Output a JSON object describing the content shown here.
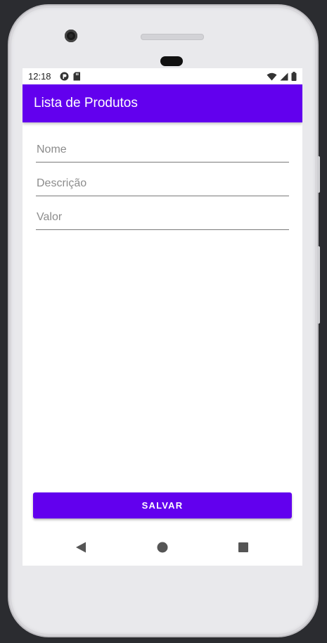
{
  "status_bar": {
    "time": "12:18",
    "left_icons": [
      "app-notification-icon",
      "sd-card-icon"
    ],
    "right_icons": [
      "wifi-icon",
      "cell-signal-icon",
      "battery-icon"
    ]
  },
  "app_bar": {
    "title": "Lista de Produtos",
    "color": "#6200ee"
  },
  "form": {
    "fields": [
      {
        "name": "nome",
        "placeholder": "Nome",
        "value": ""
      },
      {
        "name": "descricao",
        "placeholder": "Descrição",
        "value": ""
      },
      {
        "name": "valor",
        "placeholder": "Valor",
        "value": ""
      }
    ],
    "save_label": "SALVAR"
  },
  "nav_bar": {
    "buttons": [
      "back-icon",
      "home-icon",
      "recents-icon"
    ]
  }
}
